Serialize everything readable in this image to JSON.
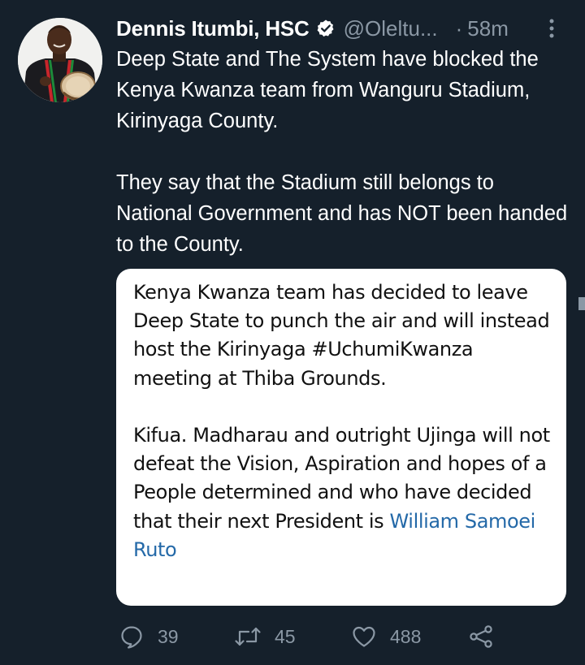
{
  "tweet": {
    "author": {
      "display_name": "Dennis Itumbi, HSC",
      "handle": "@Oleltu...",
      "verified": true
    },
    "time_prefix": "·",
    "time": "58m",
    "text_paragraphs": [
      "Deep State and The System have blocked the Kenya Kwanza team from Wanguru Stadium, Kirinyaga County.",
      "They say that the Stadium still belongs to National Government and has NOT been handed to the County."
    ],
    "attached_image": {
      "paragraph_1": "Kenya Kwanza team has decided to leave Deep State to punch the air and will instead host the Kirinyaga #UchumiKwanza meeting at Thiba Grounds.",
      "paragraph_2": "Kifua. Madharau and outright Ujinga will not defeat the Vision, Aspiration and hopes of a People determined and who have decided that their next President is",
      "mention": "William Samoei Ruto"
    },
    "actions": {
      "replies": "39",
      "retweets": "45",
      "likes": "488"
    }
  },
  "icons": {
    "verified": "verified-badge-icon",
    "more": "more-vertical-icon",
    "reply": "reply-bubble-icon",
    "retweet": "retweet-icon",
    "like": "heart-icon",
    "share": "share-icon"
  },
  "colors": {
    "background": "#15202b",
    "text_primary": "#ffffff",
    "text_secondary": "#8b98a5",
    "mention_link": "#2469a8",
    "card_background": "#ffffff"
  }
}
